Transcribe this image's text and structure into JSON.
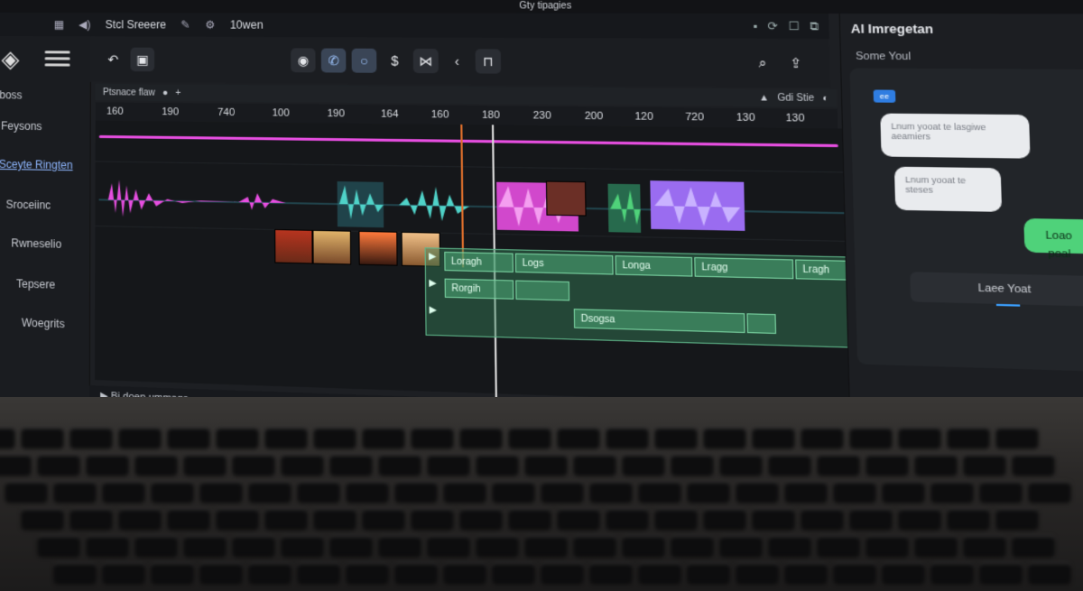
{
  "window": {
    "title": "Gty tipagies"
  },
  "menubar": {
    "project": "Stcl Sreeere",
    "user": "10wen"
  },
  "sidebar": {
    "items": [
      {
        "label": "boss"
      },
      {
        "label": "Feysons"
      },
      {
        "label": "Sceyte Ringten"
      },
      {
        "label": "Sroceiinc"
      },
      {
        "label": "Rwneselio"
      },
      {
        "label": "Tepsere"
      },
      {
        "label": "Woegrits"
      }
    ]
  },
  "toolbar": {
    "undo_icon": "undo-icon",
    "layout_icon": "layout-icon"
  },
  "track_header": {
    "label": "Ptsnace flaw",
    "right_label": "Gdi Stie"
  },
  "ruler": {
    "ticks": [
      "160",
      "190",
      "740",
      "100",
      "190",
      "164",
      "160",
      "180",
      "230",
      "200",
      "120",
      "720",
      "130",
      "130"
    ]
  },
  "text_clips": {
    "row1": [
      "Loragh",
      "Logs",
      "Longa",
      "Lragg",
      "Lragh"
    ],
    "row2": [
      "Rorgih"
    ],
    "row3": [
      "Dsogsa"
    ]
  },
  "statusbar": {
    "text": "Bi doep ummage"
  },
  "ai_panel": {
    "title": "Al Imregetan",
    "subtitle": "Some Youl",
    "tag": "ee",
    "bubble1": "Lnum yooat te lasgiwe aeamiers",
    "bubble2": "Lnum yooat te steses",
    "bubble_user": "Loao poal",
    "input": "Laee Yoat"
  },
  "colors": {
    "magenta": "#e64ee0",
    "teal": "#4fd2c8",
    "purple": "#9a6cf0",
    "green": "#4fd27a",
    "marker": "#e0702c"
  }
}
